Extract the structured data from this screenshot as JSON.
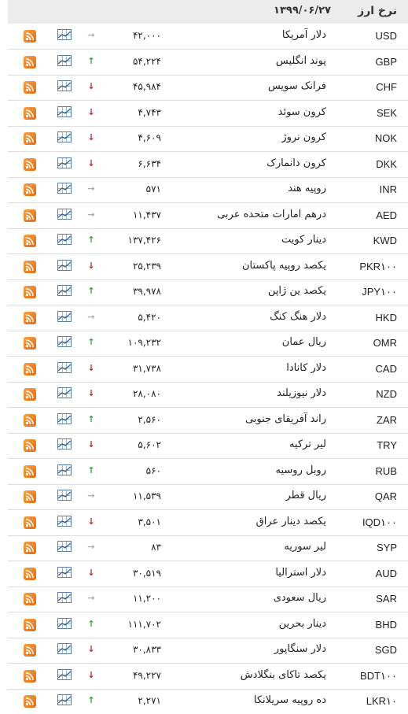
{
  "header": {
    "title": "نرخ ارز",
    "date": "۱۳۹۹/۰۶/۲۷"
  },
  "colors": {
    "up": "#2fa82f",
    "down": "#b62a2a",
    "flat": "#aaaaaa",
    "rss": "#e36b10"
  },
  "rows": [
    {
      "code": "USD",
      "name": "دلار آمریکا",
      "value": "۴۲,۰۰۰",
      "trend": "flat"
    },
    {
      "code": "GBP",
      "name": "پوند انگلیس",
      "value": "۵۴,۲۲۴",
      "trend": "up"
    },
    {
      "code": "CHF",
      "name": "فرانک سویس",
      "value": "۴۵,۹۸۴",
      "trend": "down"
    },
    {
      "code": "SEK",
      "name": "کرون سوئد",
      "value": "۴,۷۴۳",
      "trend": "down"
    },
    {
      "code": "NOK",
      "name": "کرون نروژ",
      "value": "۴,۶۰۹",
      "trend": "down"
    },
    {
      "code": "DKK",
      "name": "کرون دانمارک",
      "value": "۶,۶۳۴",
      "trend": "down"
    },
    {
      "code": "INR",
      "name": "روپیه هند",
      "value": "۵۷۱",
      "trend": "flat"
    },
    {
      "code": "AED",
      "name": "درهم امارات متحده عربی",
      "value": "۱۱,۴۳۷",
      "trend": "flat"
    },
    {
      "code": "KWD",
      "name": "دینار کویت",
      "value": "۱۳۷,۴۲۶",
      "trend": "up"
    },
    {
      "code": "PKR۱۰۰",
      "name": "یکصد روپیه پاکستان",
      "value": "۲۵,۲۳۹",
      "trend": "down"
    },
    {
      "code": "JPY۱۰۰",
      "name": "یکصد ین ژاپن",
      "value": "۳۹,۹۷۸",
      "trend": "up"
    },
    {
      "code": "HKD",
      "name": "دلار هنگ کنگ",
      "value": "۵,۴۲۰",
      "trend": "flat"
    },
    {
      "code": "OMR",
      "name": "ریال عمان",
      "value": "۱۰۹,۲۳۲",
      "trend": "up"
    },
    {
      "code": "CAD",
      "name": "دلار کانادا",
      "value": "۳۱,۷۳۸",
      "trend": "down"
    },
    {
      "code": "NZD",
      "name": "دلار نیوزیلند",
      "value": "۲۸,۰۸۰",
      "trend": "down"
    },
    {
      "code": "ZAR",
      "name": "راند آفریقای جنوبی",
      "value": "۲,۵۶۰",
      "trend": "up"
    },
    {
      "code": "TRY",
      "name": "لیر ترکیه",
      "value": "۵,۶۰۲",
      "trend": "down"
    },
    {
      "code": "RUB",
      "name": "روبل روسیه",
      "value": "۵۶۰",
      "trend": "up"
    },
    {
      "code": "QAR",
      "name": "ریال قطر",
      "value": "۱۱,۵۳۹",
      "trend": "flat"
    },
    {
      "code": "IQD۱۰۰",
      "name": "یکصد دینار عراق",
      "value": "۳,۵۰۱",
      "trend": "down"
    },
    {
      "code": "SYP",
      "name": "لیر سوریه",
      "value": "۸۳",
      "trend": "flat"
    },
    {
      "code": "AUD",
      "name": "دلار استرالیا",
      "value": "۳۰,۵۱۹",
      "trend": "down"
    },
    {
      "code": "SAR",
      "name": "ریال سعودی",
      "value": "۱۱,۲۰۰",
      "trend": "flat"
    },
    {
      "code": "BHD",
      "name": "دینار بحرین",
      "value": "۱۱۱,۷۰۲",
      "trend": "up"
    },
    {
      "code": "SGD",
      "name": "دلار سنگاپور",
      "value": "۳۰,۸۳۳",
      "trend": "down"
    },
    {
      "code": "BDT۱۰۰",
      "name": "یکصد تاکای بنگلادش",
      "value": "۴۹,۲۲۷",
      "trend": "down"
    },
    {
      "code": "LKR۱۰",
      "name": "ده روپیه سریلانکا",
      "value": "۲,۲۷۱",
      "trend": "up"
    }
  ]
}
